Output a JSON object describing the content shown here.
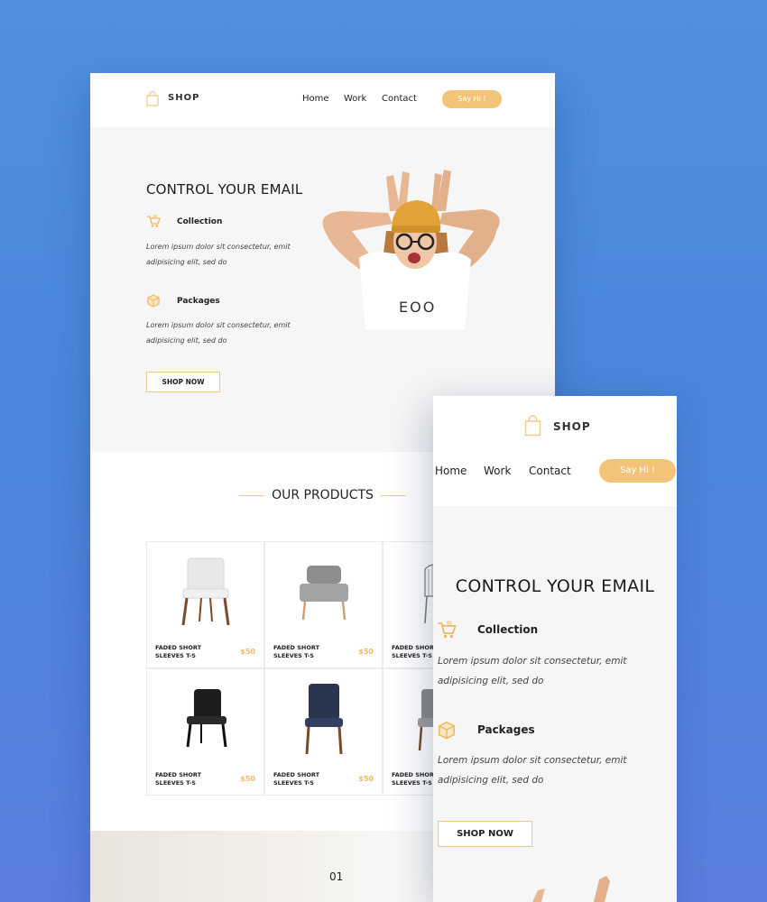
{
  "brand": {
    "name": "SHOP",
    "accent_color": "#f4c37a",
    "background_color": "#4a86dc"
  },
  "desktop": {
    "nav": [
      "Home",
      "Work",
      "Contact"
    ],
    "cta_label": "Say Hi !",
    "hero": {
      "title": "CONTROL YOUR EMAIL",
      "features": [
        {
          "icon": "shopping-cart-icon",
          "title": "Collection",
          "text": "Lorem ipsum dolor sit consectetur, emit adipisicing elit, sed do"
        },
        {
          "icon": "package-icon",
          "title": "Packages",
          "text": "Lorem ipsum dolor sit consectetur, emit adipisicing elit, sed do"
        }
      ],
      "button_label": "SHOP NOW",
      "image": "woman-with-beanie-photo"
    },
    "products": {
      "title": "OUR PRODUCTS",
      "items": [
        {
          "name": "FADED SHORT SLEEVES T-S",
          "price": "$50",
          "image": "white-chair"
        },
        {
          "name": "FADED SHORT SLEEVES T-S",
          "price": "$50",
          "image": "grey-lounge-chair"
        },
        {
          "name": "FADED SHORT SLEEVES T-S",
          "price": "",
          "image": "wire-chair"
        },
        {
          "name": "FADED SHORT SLEEVES T-S",
          "price": "$50",
          "image": "black-chair"
        },
        {
          "name": "FADED SHORT SLEEVES T-S",
          "price": "$50",
          "image": "navy-chair"
        },
        {
          "name": "FADED SHORT SLEEVES T-S",
          "price": "",
          "image": "grey-chair"
        }
      ]
    },
    "section_number": "01"
  },
  "mobile": {
    "nav": [
      "Home",
      "Work",
      "Contact"
    ],
    "cta_label": "Say Hi !",
    "hero": {
      "title": "CONTROL YOUR EMAIL",
      "features": [
        {
          "icon": "shopping-cart-icon",
          "title": "Collection",
          "text": "Lorem ipsum dolor sit consectetur, emit adipisicing elit, sed do"
        },
        {
          "icon": "package-icon",
          "title": "Packages",
          "text": "Lorem ipsum dolor sit consectetur, emit adipisicing elit, sed do"
        }
      ],
      "button_label": "SHOP NOW"
    }
  }
}
